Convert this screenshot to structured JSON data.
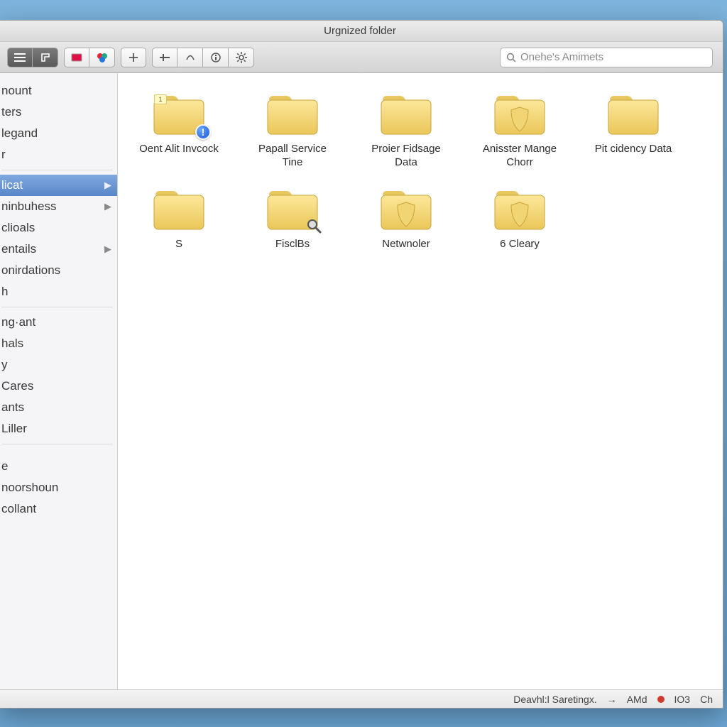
{
  "window": {
    "title": "Urgnized folder"
  },
  "toolbar": {
    "icons": {
      "list": "list-view-icon",
      "path": "path-icon",
      "tag_red": "tag-icon",
      "tag_multi": "tag-multi-icon",
      "add": "add-icon",
      "action1": "action-icon",
      "action2": "connect-icon",
      "info": "info-icon",
      "gear": "gear-icon"
    }
  },
  "search": {
    "placeholder": "Onehe's Amimets"
  },
  "sidebar": {
    "groups": [
      {
        "items": [
          {
            "label": "nount"
          },
          {
            "label": "ters"
          },
          {
            "label": "legand"
          },
          {
            "label": "r"
          }
        ]
      },
      {
        "items": [
          {
            "label": "licat",
            "arrow": true,
            "selected": true
          },
          {
            "label": "ninbuhess",
            "arrow": true
          },
          {
            "label": "clioals"
          },
          {
            "label": "entails",
            "arrow": true
          },
          {
            "label": "onirdations"
          },
          {
            "label": "h"
          }
        ]
      },
      {
        "items": [
          {
            "label": "ng·ant"
          },
          {
            "label": "hals"
          },
          {
            "label": "y"
          },
          {
            "label": "Cares"
          },
          {
            "label": "ants"
          },
          {
            "label": "Liller"
          }
        ]
      },
      {
        "items": [
          {
            "label": ""
          },
          {
            "label": "e"
          },
          {
            "label": "noorshoun"
          },
          {
            "label": "collant"
          }
        ]
      }
    ]
  },
  "folders": [
    {
      "label": "Oent Alit Invcock",
      "badge": "info",
      "note": "1"
    },
    {
      "label": "Papall Service Tine"
    },
    {
      "label": "Proier Fidsage Data"
    },
    {
      "label": "Anisster Mange Chorr",
      "variant": "shield"
    },
    {
      "label": "Pit cidency Data"
    },
    {
      "label": "S"
    },
    {
      "label": "FisclBs",
      "badge": "magnify"
    },
    {
      "label": "Netwnoler",
      "variant": "shield"
    },
    {
      "label": "6 Cleary",
      "variant": "shield"
    }
  ],
  "statusbar": {
    "text1": "Deavhl:l Saretingx.",
    "arrow": "→",
    "text2": "AMd",
    "text3": "IO3",
    "text4": "Ch"
  }
}
